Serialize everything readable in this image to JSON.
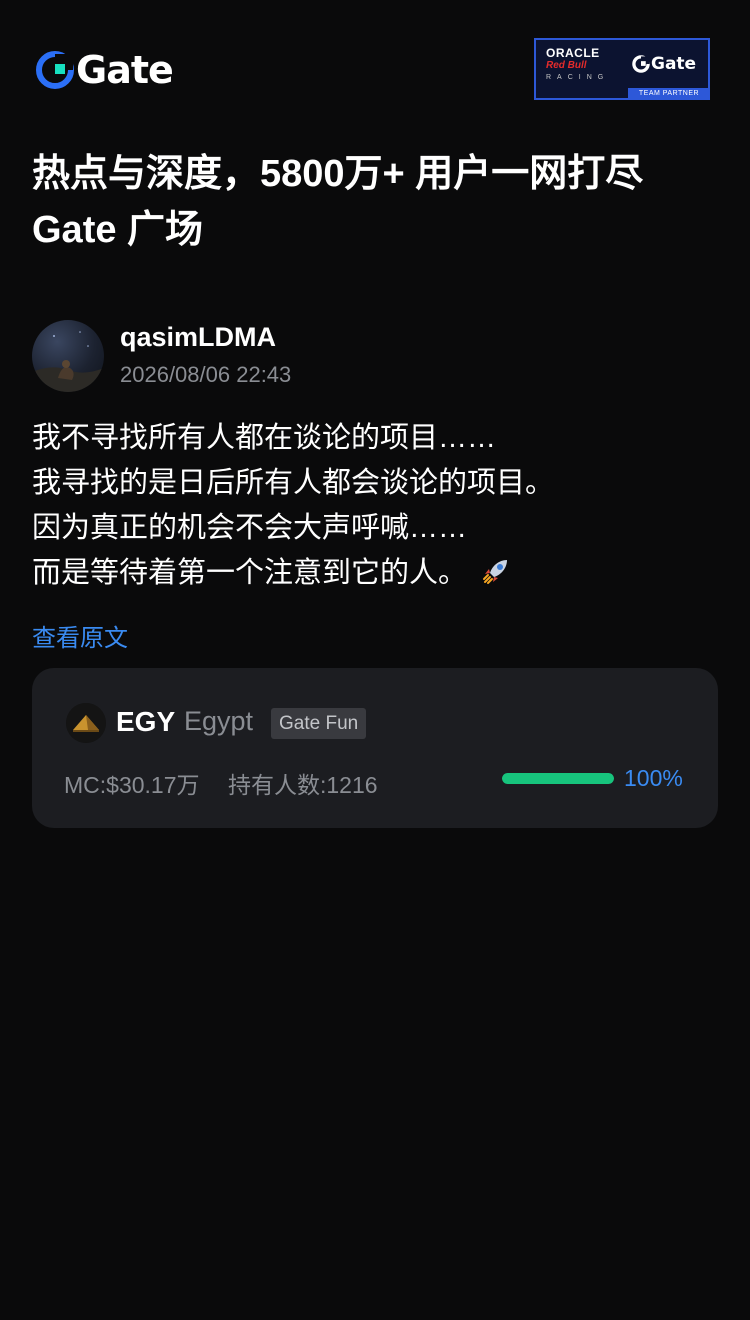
{
  "header": {
    "logo_text": "Gate",
    "partner_badge": {
      "line1": "ORACLE",
      "line2": "Red Bull",
      "line3": "RACING",
      "brand": "Gate",
      "footer": "TEAM PARTNER"
    }
  },
  "headline": {
    "line1": "热点与深度，5800万+ 用户一网打尽",
    "line2": "Gate 广场"
  },
  "post": {
    "author": "qasimLDMA",
    "timestamp": "2026/08/06 22:43",
    "lines": [
      "我不寻找所有人都在谈论的项目……",
      "我寻找的是日后所有人都会谈论的项目。",
      "因为真正的机会不会大声呼喊……",
      "而是等待着第一个注意到它的人。"
    ],
    "emoji_icon": "rocket-icon",
    "view_original": "查看原文"
  },
  "token_card": {
    "symbol": "EGY",
    "name": "Egypt",
    "tag": "Gate Fun",
    "market_cap": "MC:$30.17万",
    "holders": "持有人数:1216",
    "progress_percent": 100,
    "progress_label": "100%"
  },
  "colors": {
    "background": "#0a0a0b",
    "card": "#1c1d21",
    "accent_blue": "#3a8bf2",
    "progress_green": "#17c47d",
    "muted_text": "#8a8d93"
  }
}
